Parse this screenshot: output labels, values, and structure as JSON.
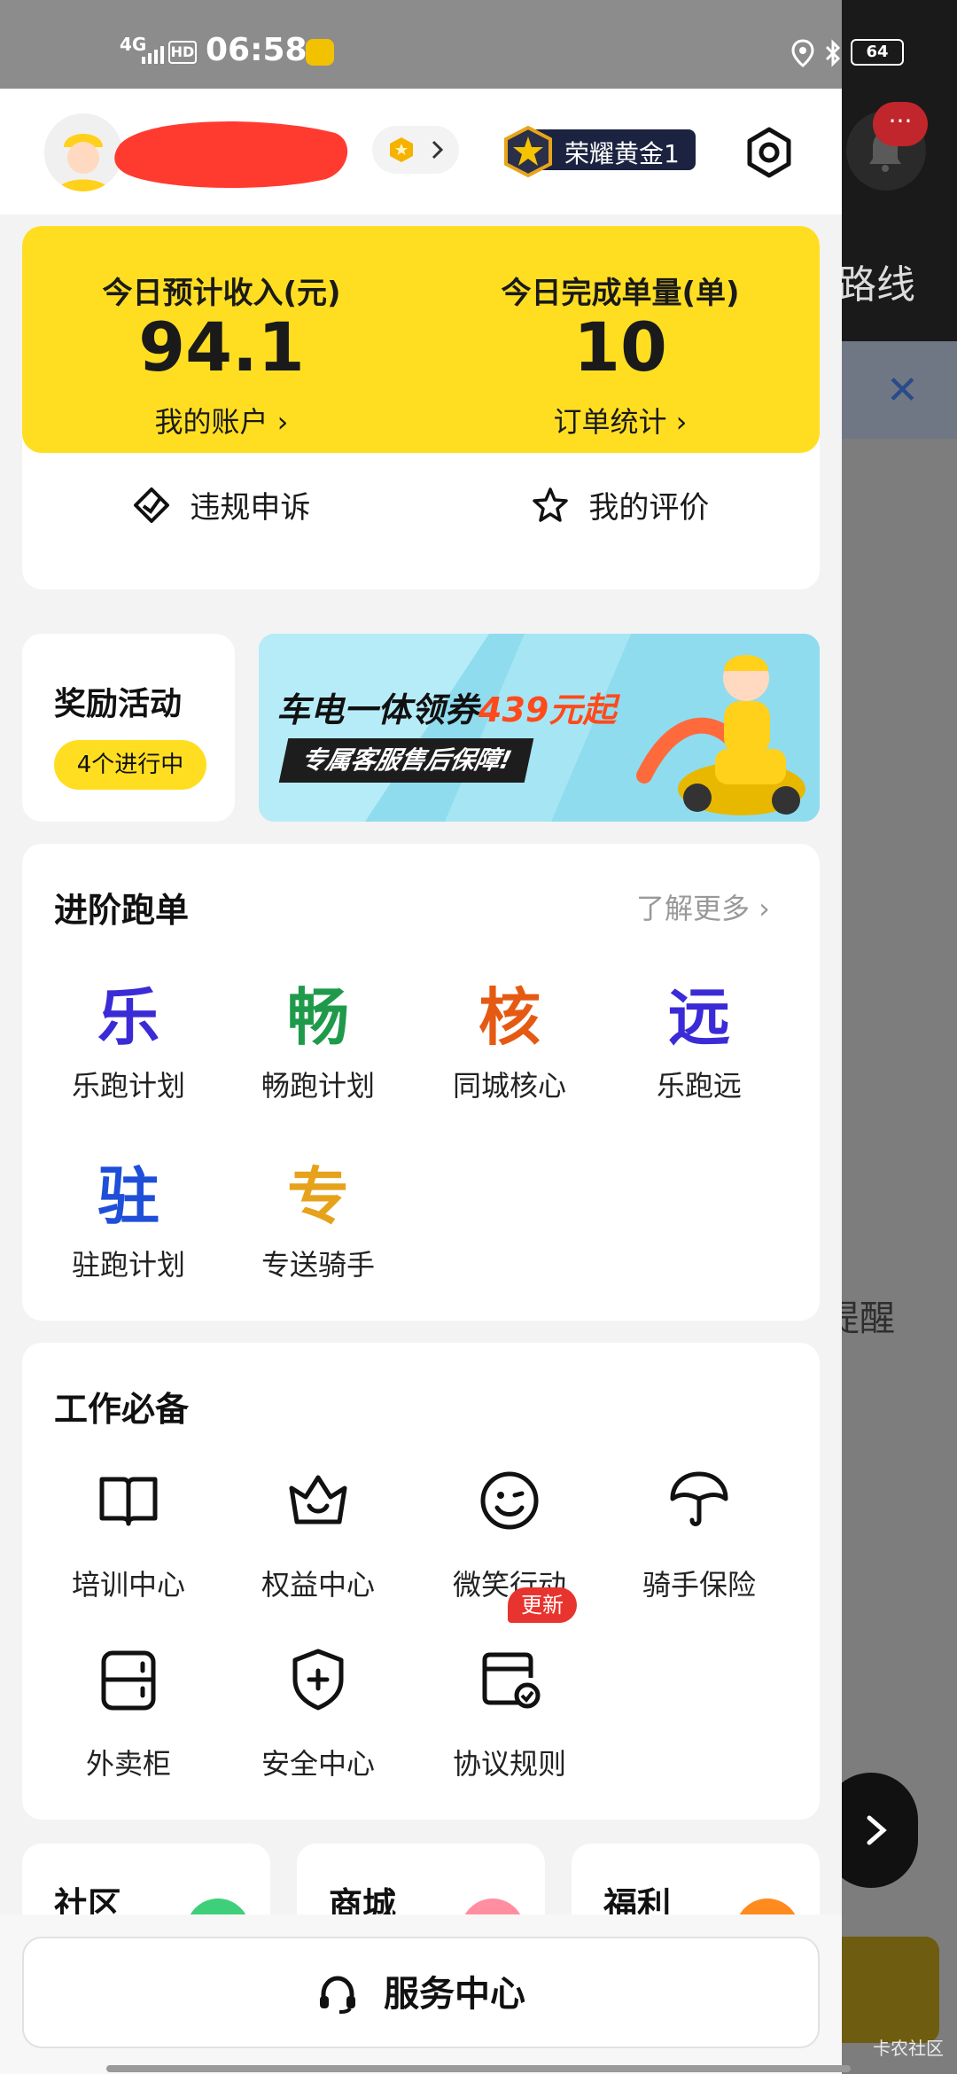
{
  "status_bar": {
    "network": "4G",
    "hd": "HD",
    "time": "06:58",
    "battery": "64"
  },
  "background_app": {
    "route_label": "路线",
    "reminder_label": "提醒",
    "more_label": "···",
    "watermark": "卡农社区"
  },
  "header": {
    "rank_label": "荣耀黄金1"
  },
  "earnings": {
    "income_label": "今日预计收入(元)",
    "income_value": "94.1",
    "account_link": "我的账户 ›",
    "orders_label": "今日完成单量(单)",
    "orders_value": "10",
    "stats_link": "订单统计 ›",
    "appeal_label": "违规申诉",
    "rating_label": "我的评价"
  },
  "rewards": {
    "title": "奖励活动",
    "pill": "4个进行中",
    "banner_text_prefix": "车电一体领券",
    "banner_price": "439元起",
    "banner_sub": "专属客服售后保障!"
  },
  "advanced": {
    "title": "进阶跑单",
    "more": "了解更多 ›",
    "items": [
      {
        "glyph": "乐",
        "label": "乐跑计划",
        "color": "#3b2bd6"
      },
      {
        "glyph": "畅",
        "label": "畅跑计划",
        "color": "#1e9a4a"
      },
      {
        "glyph": "核",
        "label": "同城核心",
        "color": "#e55a12"
      },
      {
        "glyph": "远",
        "label": "乐跑远",
        "color": "#3b2bd6"
      },
      {
        "glyph": "驻",
        "label": "驻跑计划",
        "color": "#1f4fd8"
      },
      {
        "glyph": "专",
        "label": "专送骑手",
        "color": "#e6a21a"
      }
    ]
  },
  "work": {
    "title": "工作必备",
    "items": [
      {
        "label": "培训中心",
        "icon": "book-icon"
      },
      {
        "label": "权益中心",
        "icon": "crown-icon"
      },
      {
        "label": "微笑行动",
        "icon": "smile-icon"
      },
      {
        "label": "骑手保险",
        "icon": "umbrella-icon"
      },
      {
        "label": "外卖柜",
        "icon": "locker-icon"
      },
      {
        "label": "安全中心",
        "icon": "shield-icon"
      },
      {
        "label": "协议规则",
        "icon": "agreement-icon"
      }
    ],
    "new_badge": "更新"
  },
  "bottom_cards": [
    {
      "title": "社区",
      "color": "#3ecf7a"
    },
    {
      "title": "商城",
      "color": "#ff8fa0"
    },
    {
      "title": "福利",
      "color": "#ff8a1e"
    }
  ],
  "service_button": "服务中心"
}
